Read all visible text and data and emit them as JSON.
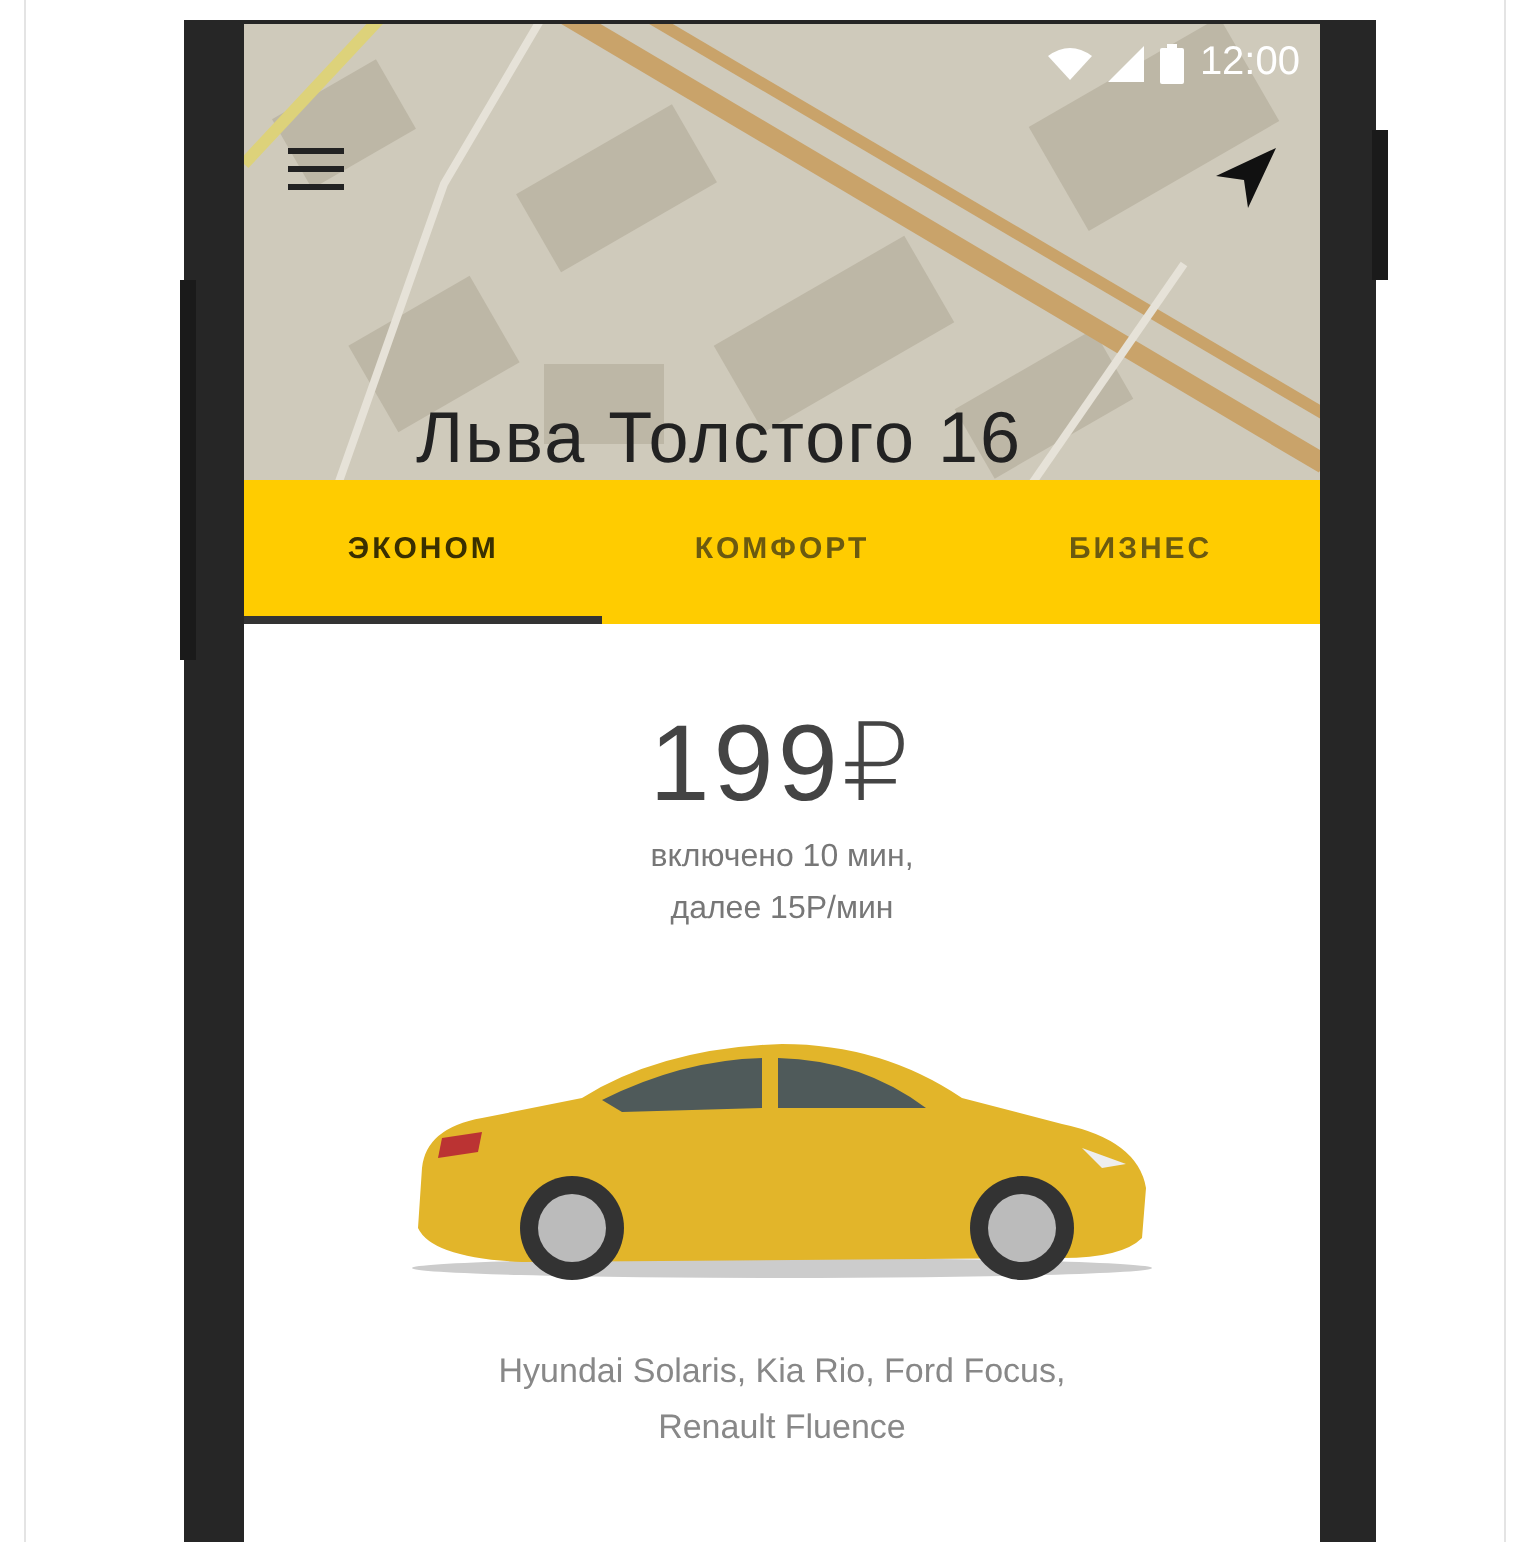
{
  "status_bar": {
    "time": "12:00"
  },
  "map": {
    "address": "Льва Толстого 16"
  },
  "tabs": [
    {
      "label": "ЭКОНОМ",
      "selected": true
    },
    {
      "label": "КОМФОРТ",
      "selected": false
    },
    {
      "label": "БИЗНЕС",
      "selected": false
    }
  ],
  "tariff": {
    "price": "199₽",
    "details": "включено 10 мин,\nдалее 15Р/мин",
    "car_models": "Hyundai Solaris, Kia Rio, Ford Focus,\nRenault Fluence"
  }
}
